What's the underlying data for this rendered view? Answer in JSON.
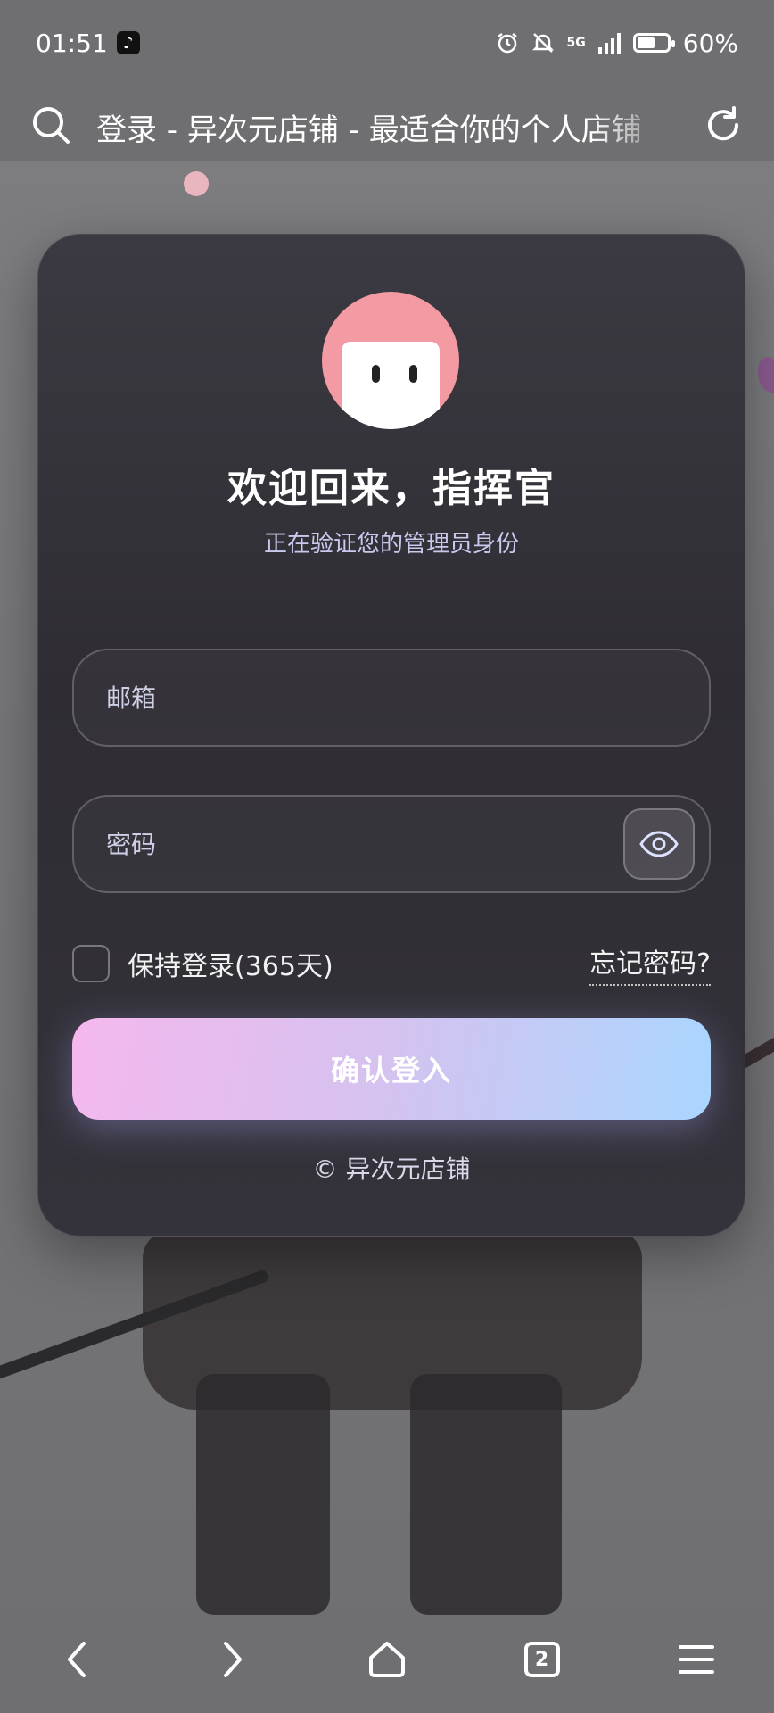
{
  "status_bar": {
    "time": "01:51",
    "network": "5G",
    "battery": "60%",
    "battery_level": 0.6
  },
  "address_bar": {
    "title": "登录 - 异次元店铺 - 最适合你的个人店铺"
  },
  "login": {
    "welcome": "欢迎回来，指挥官",
    "subtitle": "正在验证您的管理员身份",
    "email_placeholder": "邮箱",
    "password_placeholder": "密码",
    "remember_label": "保持登录(365天)",
    "forgot_label": "忘记密码?",
    "submit_label": "确认登入",
    "footer": "© 异次元店铺"
  },
  "bottom_nav": {
    "tabs_count": "2"
  },
  "colors": {
    "accent_start": "#f5b8ee",
    "accent_end": "#a9d6ff",
    "avatar_bg": "#f39aa2"
  }
}
